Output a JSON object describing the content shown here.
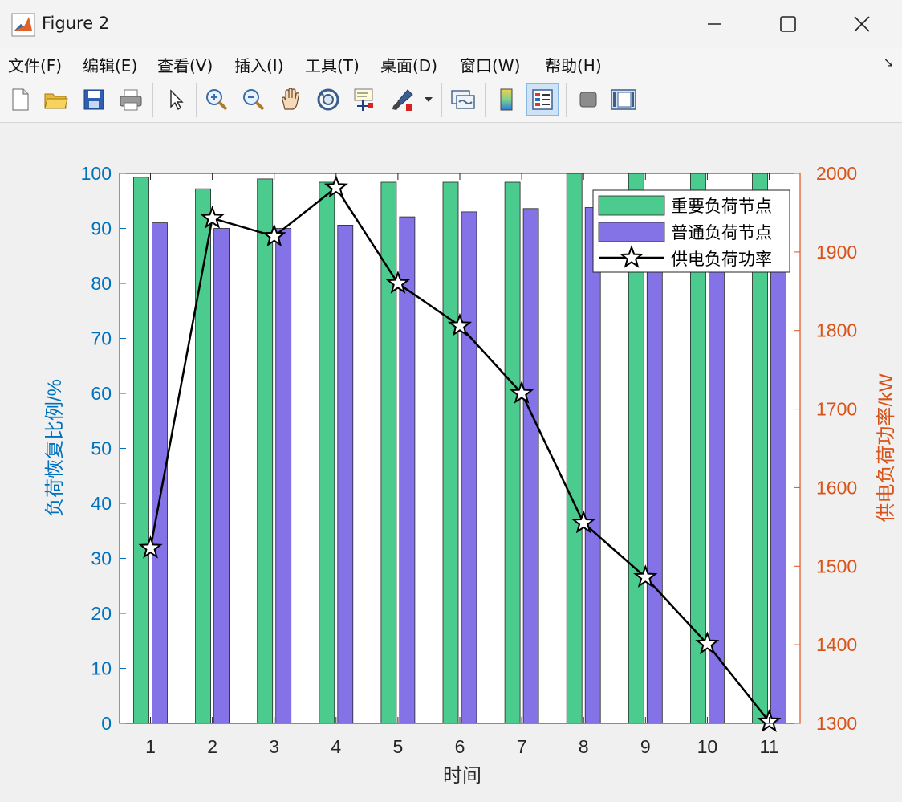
{
  "window": {
    "title": "Figure 2"
  },
  "menu": [
    "文件(F)",
    "编辑(E)",
    "查看(V)",
    "插入(I)",
    "工具(T)",
    "桌面(D)",
    "窗口(W)",
    "帮助(H)"
  ],
  "toolbar_icons": [
    "new-file-icon",
    "open-folder-icon",
    "save-icon",
    "print-icon",
    "pointer-icon",
    "zoom-in-icon",
    "zoom-out-icon",
    "pan-hand-icon",
    "rotate-3d-icon",
    "data-cursor-icon",
    "brush-icon",
    "link-plot-icon",
    "colorbar-icon",
    "legend-icon",
    "hide-plot-tools-icon",
    "show-plot-tools-icon"
  ],
  "colors": {
    "left_axis": "#0072BD",
    "right_axis": "#D95319",
    "important": "#4BCB8E",
    "normal": "#8373E6",
    "power": "#000000"
  },
  "chart_data": {
    "type": "bar",
    "categories": [
      "1",
      "2",
      "3",
      "4",
      "5",
      "6",
      "7",
      "8",
      "9",
      "10",
      "11"
    ],
    "xlabel": "时间",
    "ylabel": "负荷恢复比例/%",
    "ylim": [
      0,
      100
    ],
    "yticks": [
      "0",
      "10",
      "20",
      "30",
      "40",
      "50",
      "60",
      "70",
      "80",
      "90",
      "100"
    ],
    "series": [
      {
        "name": "重要负荷节点",
        "values": [
          99.3,
          97.2,
          99,
          98.4,
          98.4,
          98.4,
          98.4,
          100,
          100,
          100,
          100
        ]
      },
      {
        "name": "普通负荷节点",
        "values": [
          91,
          90,
          90,
          90.6,
          92.1,
          93,
          93.6,
          93.8,
          93.8,
          93.8,
          93
        ]
      }
    ],
    "secondary": {
      "type": "line",
      "name": "供电负荷功率",
      "ylabel": "供电负荷功率/kW",
      "ylim": [
        1300,
        2000
      ],
      "yticks": [
        "1300",
        "1400",
        "1500",
        "1600",
        "1700",
        "1800",
        "1900",
        "2000"
      ],
      "values": [
        1523,
        1943,
        1920,
        1982,
        1860,
        1806,
        1720,
        1555,
        1486,
        1401,
        1302
      ],
      "marker": "pentagram"
    },
    "legend": "top-right"
  }
}
